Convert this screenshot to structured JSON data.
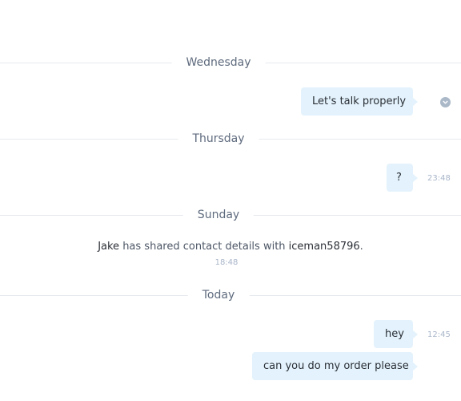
{
  "days": {
    "wednesday": "Wednesday",
    "thursday": "Thursday",
    "sunday": "Sunday",
    "today": "Today"
  },
  "messages": {
    "m1": {
      "text": "Let's talk properly",
      "status_icon": "chevron-down-icon"
    },
    "m2": {
      "text": "?",
      "time": "23:48"
    },
    "system": {
      "actor": "Jake",
      "text": " has shared contact details with ",
      "target": "iceman58796",
      "period": ".",
      "time": "18:48"
    },
    "m3": {
      "text": "hey",
      "time": "12:45"
    },
    "m4": {
      "text": "can you do my order please"
    }
  },
  "colors": {
    "bubble": "#e3f2fc",
    "separator_line": "#e6e9ee",
    "day_label": "#5f6b7e",
    "timestamp": "#a9b6c9"
  }
}
